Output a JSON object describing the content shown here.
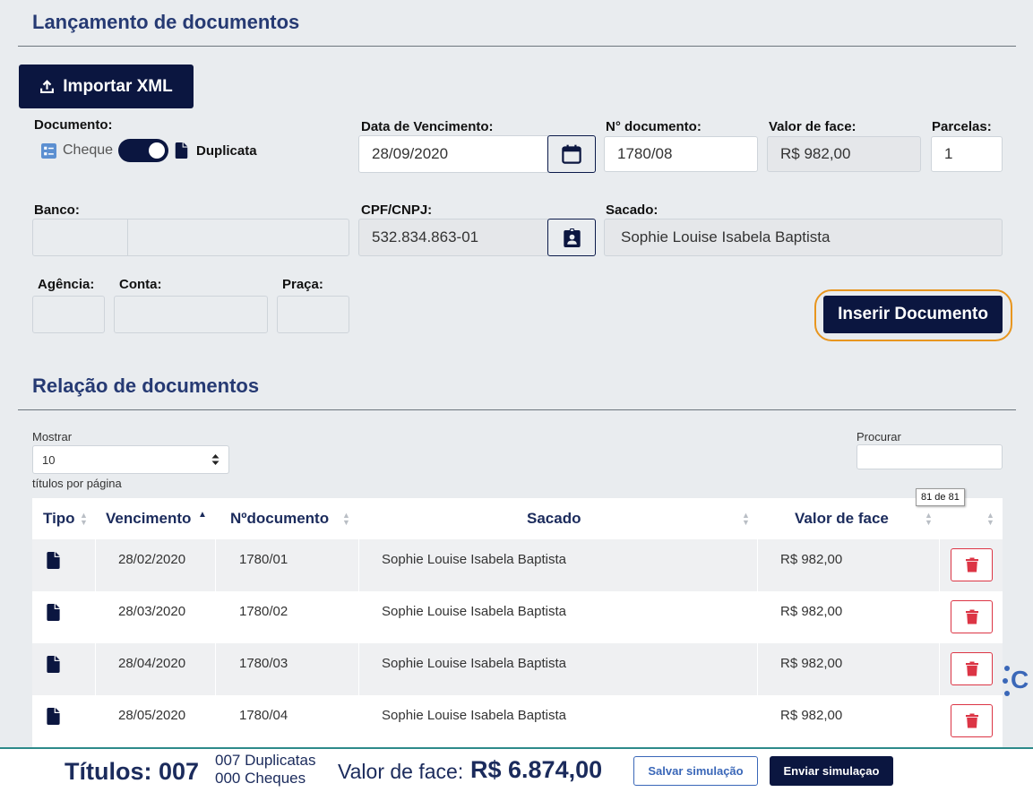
{
  "header": {
    "title": "Lançamento de documentos"
  },
  "import_button": {
    "label": "Importar XML"
  },
  "documento": {
    "label": "Documento:",
    "option_cheque": "Cheque",
    "option_duplicata": "Duplicata"
  },
  "vencimento": {
    "label": "Data de Vencimento:",
    "value": "28/09/2020"
  },
  "ndoc": {
    "label": "N° documento:",
    "value": "1780/08"
  },
  "valor_face": {
    "label": "Valor de face:",
    "value": "R$ 982,00"
  },
  "parcelas": {
    "label": "Parcelas:",
    "value": "1"
  },
  "banco": {
    "label": "Banco:",
    "code": "",
    "name": ""
  },
  "cpf": {
    "label": "CPF/CNPJ:",
    "value": "532.834.863-01"
  },
  "sacado": {
    "label": "Sacado:",
    "value": "Sophie Louise Isabela Baptista"
  },
  "agencia": {
    "label": "Agência:",
    "value": ""
  },
  "conta": {
    "label": "Conta:",
    "value": ""
  },
  "praca": {
    "label": "Praça:",
    "value": ""
  },
  "insert_button": {
    "label": "Inserir Documento"
  },
  "relacao": {
    "title": "Relação de documentos"
  },
  "table_controls": {
    "show_label": "Mostrar",
    "page_size": "10",
    "per_page_label": "títulos por página",
    "search_label": "Procurar",
    "search_value": "",
    "tooltip": "81 de 81"
  },
  "table": {
    "headers": {
      "tipo": "Tipo",
      "vencimento": "Vencimento",
      "ndoc": "Nºdocumento",
      "sacado": "Sacado",
      "valor": "Valor de face"
    },
    "rows": [
      {
        "vencimento": "28/02/2020",
        "ndoc": "1780/01",
        "sacado": "Sophie Louise Isabela Baptista",
        "valor": "R$ 982,00"
      },
      {
        "vencimento": "28/03/2020",
        "ndoc": "1780/02",
        "sacado": "Sophie Louise Isabela Baptista",
        "valor": "R$ 982,00"
      },
      {
        "vencimento": "28/04/2020",
        "ndoc": "1780/03",
        "sacado": "Sophie Louise Isabela Baptista",
        "valor": "R$ 982,00"
      },
      {
        "vencimento": "28/05/2020",
        "ndoc": "1780/04",
        "sacado": "Sophie Louise Isabela Baptista",
        "valor": "R$ 982,00"
      }
    ]
  },
  "side_logo": {
    "text": "C"
  },
  "footer": {
    "titulos_label": "Títulos: 007",
    "duplicatas": "007 Duplicatas",
    "cheques": "000 Cheques",
    "valor_label": "Valor de face:",
    "valor_total": "R$ 6.874,00",
    "save_label": "Salvar simulação",
    "send_label": "Enviar simulaçao"
  },
  "colors": {
    "primary": "#0b1640",
    "title": "#263a73",
    "danger": "#dc3545",
    "focus_ring": "#e8961f"
  }
}
